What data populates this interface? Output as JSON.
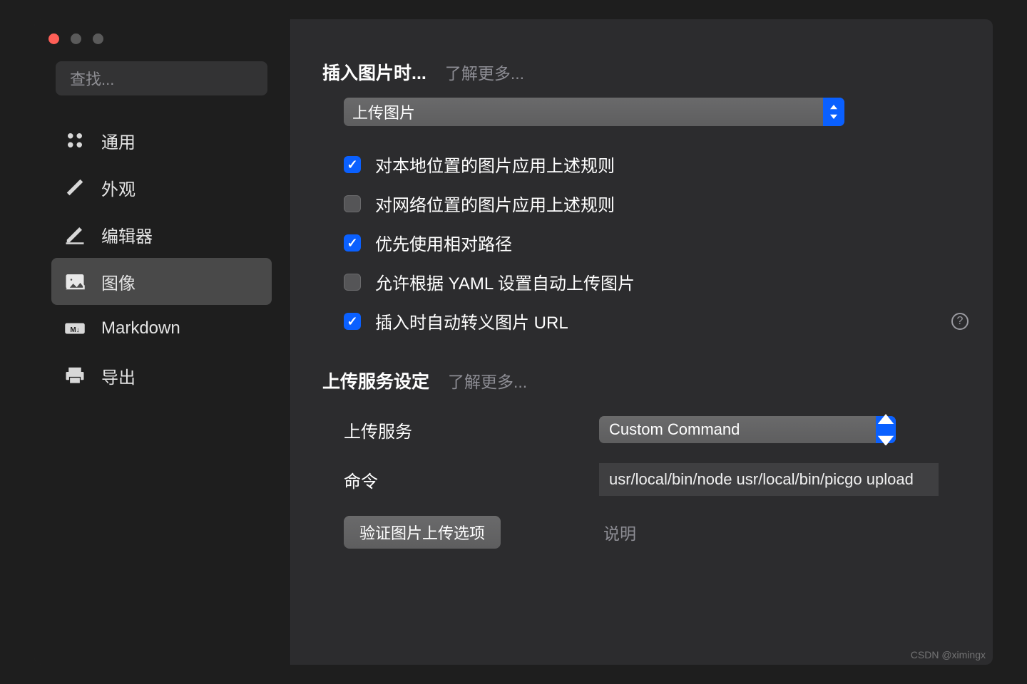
{
  "search": {
    "placeholder": "查找..."
  },
  "sidebar": {
    "items": [
      {
        "label": "通用"
      },
      {
        "label": "外观"
      },
      {
        "label": "编辑器"
      },
      {
        "label": "图像"
      },
      {
        "label": "Markdown"
      },
      {
        "label": "导出"
      }
    ]
  },
  "section_insert": {
    "title": "插入图片时...",
    "learn_more": "了解更多...",
    "select_value": "上传图片",
    "checks": [
      {
        "label": "对本地位置的图片应用上述规则",
        "checked": true
      },
      {
        "label": "对网络位置的图片应用上述规则",
        "checked": false
      },
      {
        "label": "优先使用相对路径",
        "checked": true
      },
      {
        "label": "允许根据 YAML 设置自动上传图片",
        "checked": false
      },
      {
        "label": "插入时自动转义图片 URL",
        "checked": true
      }
    ]
  },
  "section_upload": {
    "title": "上传服务设定",
    "learn_more": "了解更多...",
    "service_label": "上传服务",
    "service_value": "Custom Command",
    "command_label": "命令",
    "command_value": "usr/local/bin/node usr/local/bin/picgo upload",
    "verify_button": "验证图片上传选项",
    "description_label": "说明"
  },
  "watermark": "CSDN @ximingx"
}
